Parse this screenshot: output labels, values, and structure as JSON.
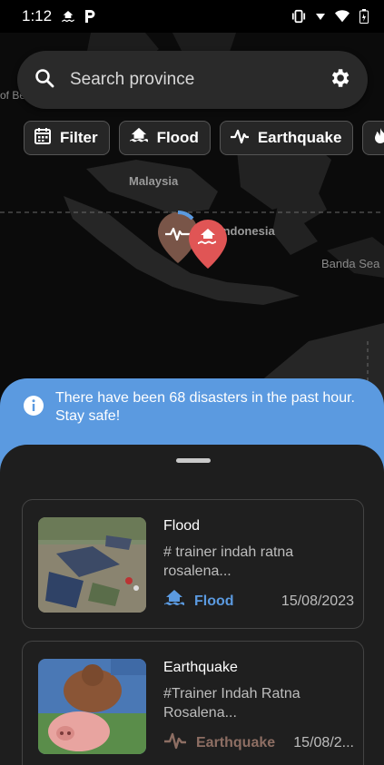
{
  "status_bar": {
    "time": "1:12"
  },
  "search": {
    "placeholder": "Search province"
  },
  "filters": [
    {
      "label": "Filter",
      "icon": "calendar-icon"
    },
    {
      "label": "Flood",
      "icon": "flood-icon"
    },
    {
      "label": "Earthquake",
      "icon": "earthquake-icon"
    },
    {
      "label": "",
      "icon": "fire-icon"
    }
  ],
  "map": {
    "labels": {
      "malaysia": "Malaysia",
      "indonesia": "Indonesia",
      "banda_sea": "Banda Sea",
      "left_fragment": "of Be"
    }
  },
  "banner": {
    "message": "There have been 68 disasters in the past hour. Stay safe!",
    "color": "#5b9ae0"
  },
  "reports": [
    {
      "title": "Flood",
      "description": "# trainer indah ratna rosalena...",
      "type": "Flood",
      "type_color": "#5b9ae0",
      "date": "15/08/2023"
    },
    {
      "title": "Earthquake",
      "description": "#Trainer Indah Ratna Rosalena...",
      "type": "Earthquake",
      "type_color": "#8d6e63",
      "date": "15/08/2..."
    }
  ]
}
